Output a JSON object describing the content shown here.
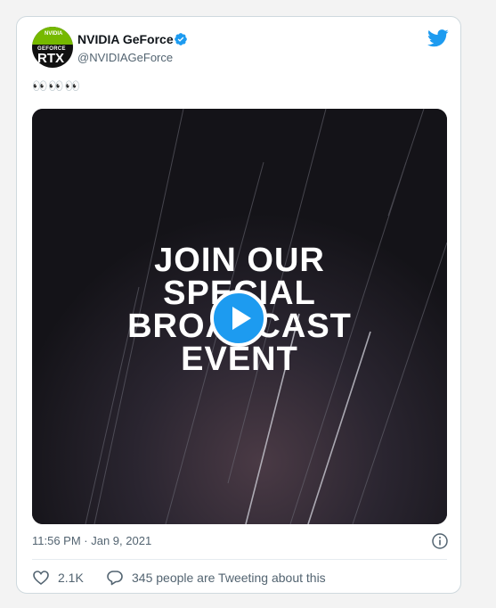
{
  "tweet": {
    "author_name": "NVIDIA GeForce",
    "author_handle": "@NVIDIAGeForce",
    "avatar": {
      "brand": "NVIDIA",
      "line1": "GEFORCE",
      "line2": "RTX"
    },
    "text": "👀👀👀",
    "media": {
      "headline_lines": [
        "JOIN OUR",
        "SPECIAL",
        "BROADCAST",
        "EVENT"
      ]
    },
    "timestamp": "11:56 PM · Jan 9, 2021",
    "like_count": "2.1K",
    "tweeting_text": "345 people are Tweeting about this"
  },
  "icons": {
    "verified": "verified-badge-icon",
    "twitter": "twitter-bird-icon",
    "play": "play-icon",
    "info": "info-icon",
    "heart": "heart-icon",
    "reply": "reply-icon"
  },
  "colors": {
    "twitter_blue": "#1d9bf0",
    "nvidia_green": "#76b900",
    "text_primary": "#0f1419",
    "text_secondary": "#536471"
  }
}
